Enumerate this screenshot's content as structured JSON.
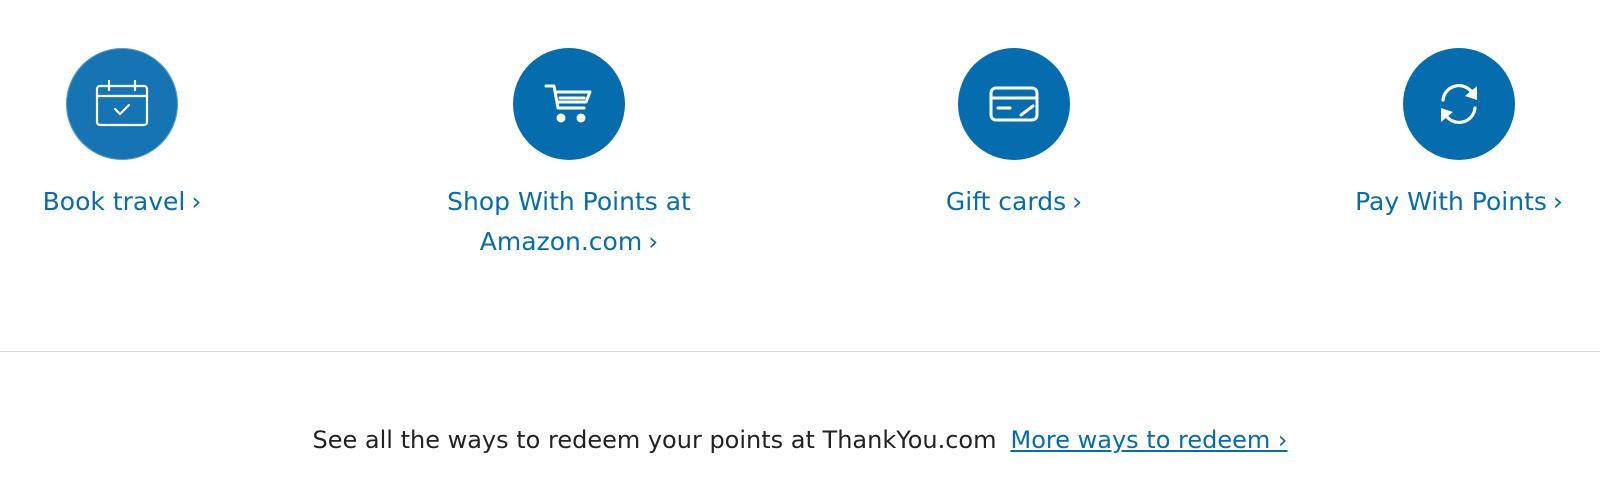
{
  "colors": {
    "brand_blue": "#056dae",
    "text_dark": "#222222",
    "divider": "#d9d9d9",
    "white": "#ffffff"
  },
  "tiles": [
    {
      "label": "Book travel",
      "chevron": "›",
      "icon": "calendar-check-icon"
    },
    {
      "label": "Shop With Points at Amazon.com",
      "chevron": "›",
      "icon": "shopping-cart-icon"
    },
    {
      "label": "Gift cards",
      "chevron": "›",
      "icon": "gift-card-icon"
    },
    {
      "label": "Pay With Points",
      "chevron": "›",
      "icon": "refresh-arrows-icon"
    }
  ],
  "footer": {
    "text": "See all the ways to redeem your points at ThankYou.com",
    "link_label": "More ways to redeem ›"
  }
}
